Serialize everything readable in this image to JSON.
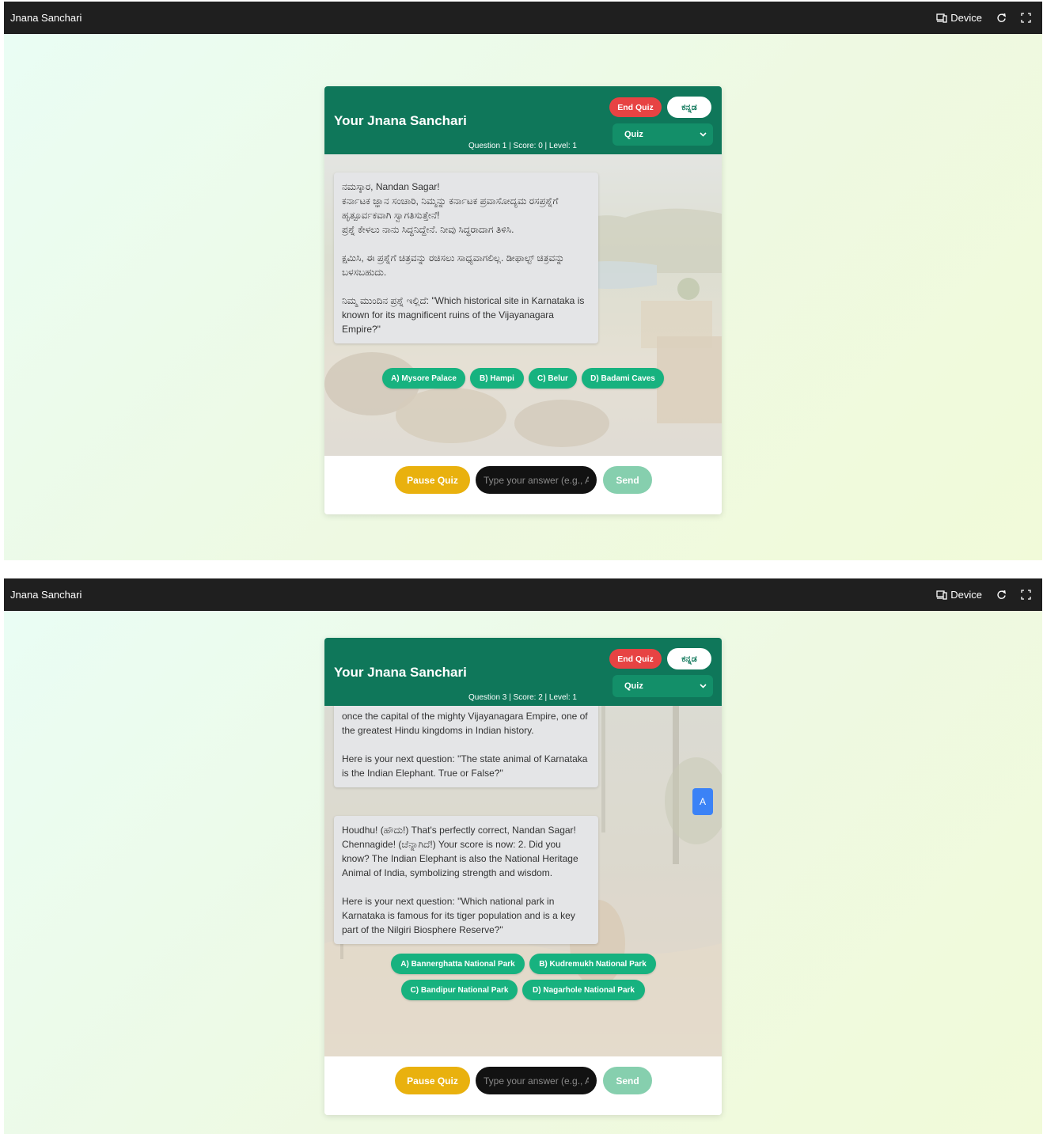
{
  "app_title": "Jnana Sanchari",
  "topbar": {
    "device_label": "Device"
  },
  "header": {
    "title": "Your Jnana Sanchari",
    "end_quiz": "End Quiz",
    "language_toggle": "ಕನ್ನಡ",
    "mode_selected": "Quiz"
  },
  "footer": {
    "pause_label": "Pause Quiz",
    "answer_placeholder": "Type your answer (e.g., A or B)",
    "send_label": "Send"
  },
  "colors": {
    "header": "#0f775a",
    "end_quiz": "#e74343",
    "option_pill": "#17b27f",
    "pause": "#e9b10e",
    "send": "#86cfae",
    "float_button": "#3b82f6"
  },
  "screen1": {
    "status": "Question 1 | Score: 0 | Level: 1",
    "messages": [
      {
        "paragraphs": [
          "ನಮಸ್ಕಾರ, Nandan Sagar!\nಕರ್ನಾಟಕ ಜ್ಞಾನ ಸಂಚಾರಿ, ನಿಮ್ಮನ್ನು ಕರ್ನಾಟಕ ಪ್ರವಾಸೋದ್ಯಮ ರಸಪ್ರಶ್ನೆಗೆ ಹೃತ್ಪೂರ್ವಕವಾಗಿ ಸ್ವಾಗತಿಸುತ್ತೇನೆ!\nಪ್ರಶ್ನೆ ಕೇಳಲು ನಾನು ಸಿದ್ಧನಿದ್ದೇನೆ. ನೀವು ಸಿದ್ಧರಾದಾಗ ತಿಳಿಸಿ.",
          "ಕ್ಷಮಿಸಿ, ಈ ಪ್ರಶ್ನೆಗೆ ಚಿತ್ರವನ್ನು ರಚಿಸಲು ಸಾಧ್ಯವಾಗಲಿಲ್ಲ. ಡೀಫಾಲ್ಟ್ ಚಿತ್ರವನ್ನು ಬಳಸಬಹುದು.",
          "ನಿಮ್ಮ ಮುಂದಿನ ಪ್ರಶ್ನೆ ಇಲ್ಲಿದೆ: \"Which historical site in Karnataka is known for its magnificent ruins of the Vijayanagara Empire?\""
        ]
      }
    ],
    "options": [
      "A) Mysore Palace",
      "B) Hampi",
      "C) Belur",
      "D) Badami Caves"
    ]
  },
  "screen2": {
    "status": "Question 3 | Score: 2 | Level: 1",
    "float_button": "A",
    "messages": [
      {
        "paragraphs": [
          "once the capital of the mighty Vijayanagara Empire, one of the greatest Hindu kingdoms in Indian history.",
          "Here is your next question: \"The state animal of Karnataka is the Indian Elephant. True or False?\""
        ]
      },
      {
        "paragraphs": [
          "Houdhu! (ಹೌದು!) That's perfectly correct, Nandan Sagar! Chennagide! (ಚೆನ್ನಾಗಿದೆ!) Your score is now: 2. Did you know? The Indian Elephant is also the National Heritage Animal of India, symbolizing strength and wisdom.",
          "Here is your next question: \"Which national park in Karnataka is famous for its tiger population and is a key part of the Nilgiri Biosphere Reserve?\""
        ]
      }
    ],
    "options": [
      "A) Bannerghatta National Park",
      "B) Kudremukh National Park",
      "C) Bandipur National Park",
      "D) Nagarhole National Park"
    ]
  }
}
